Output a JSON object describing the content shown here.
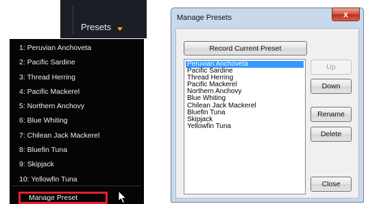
{
  "presets_menu": {
    "button_label": "Presets",
    "items": [
      "1: Peruvian Anchoveta",
      "2: Pacific Sardine",
      "3: Thread Herring",
      "4: Pacific Mackerel",
      "5: Northern Anchovy",
      "6: Blue Whiting",
      "7: Chilean Jack Mackerel",
      "8: Bluefin Tuna",
      "9: Skipjack",
      "10: Yellowfin Tuna"
    ],
    "manage_label": "Manage Preset",
    "highlight_color": "#e8202a",
    "arrow_color": "#f2b51a"
  },
  "dialog": {
    "title": "Manage Presets",
    "close_glyph": "x",
    "record_button": "Record Current Preset",
    "list": [
      "Peruvian Anchoveta",
      "Pacific Sardine",
      "Thread Herring",
      "Pacific Mackerel",
      "Northern Anchovy",
      "Blue Whiting",
      "Chilean Jack Mackerel",
      "Bluefin Tuna",
      "Skipjack",
      "Yellowfin Tuna"
    ],
    "selected_item": "Peruvian Anchoveta",
    "buttons": {
      "up": "Up",
      "down": "Down",
      "rename": "Rename",
      "delete": "Delete",
      "close": "Close"
    },
    "selection_color": "#3399ff"
  }
}
